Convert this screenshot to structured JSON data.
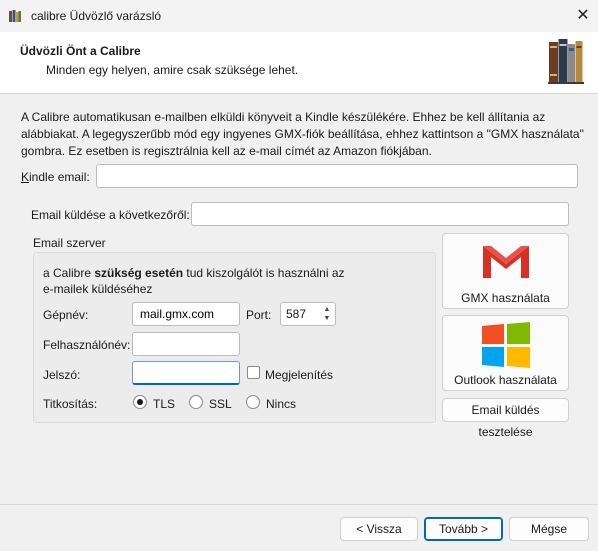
{
  "window": {
    "title": "calibre Üdvözlő varázsló",
    "close_glyph": "✕"
  },
  "header": {
    "title": "Üdvözli Önt a Calibre",
    "subtitle": "Minden egy helyen, amire csak szüksége lehet."
  },
  "intro_text": "A Calibre automatikusan e-mailben elküldi könyveit a Kindle készülékére. Ehhez be kell állítania az alábbiakat. A legegyszerűbb mód egy ingyenes GMX-fiók beállítása, ehhez kattintson a \"GMX használata\" gombra. Ez esetben is regisztrálnia kell az e-mail címét az Amazon fiókjában.",
  "form": {
    "kindle_email": {
      "label": "Kindle email:",
      "value": ""
    },
    "send_from": {
      "label": "Email küldése a következőről:",
      "value": ""
    }
  },
  "server": {
    "group_title": "Email szerver",
    "note_pre": "a Calibre ",
    "note_bold": "szükség esetén",
    "note_post": " tud kiszolgálót is használni az e-mailek küldéséhez",
    "host": {
      "label": "Gépnév:",
      "value": "mail.gmx.com"
    },
    "port": {
      "label": "Port:",
      "value": "587"
    },
    "username": {
      "label": "Felhasználónév:",
      "value": ""
    },
    "password": {
      "label": "Jelszó:",
      "value": ""
    },
    "show_password": {
      "label": "Megjelenítés",
      "checked": false
    },
    "encryption": {
      "label": "Titkosítás:",
      "options": [
        "TLS",
        "SSL",
        "Nincs"
      ],
      "selected": "TLS"
    }
  },
  "side_buttons": {
    "gmx": "GMX használata",
    "outlook": "Outlook használata",
    "test": "Email küldés tesztelése"
  },
  "footer": {
    "back": "< Vissza",
    "next": "Tovább >",
    "cancel": "Mégse"
  },
  "colors": {
    "gmail_red": "#d93025",
    "ms_red": "#f25022",
    "ms_green": "#7fba00",
    "ms_blue": "#00a4ef",
    "ms_yellow": "#ffb900",
    "accent": "#0067c0"
  }
}
